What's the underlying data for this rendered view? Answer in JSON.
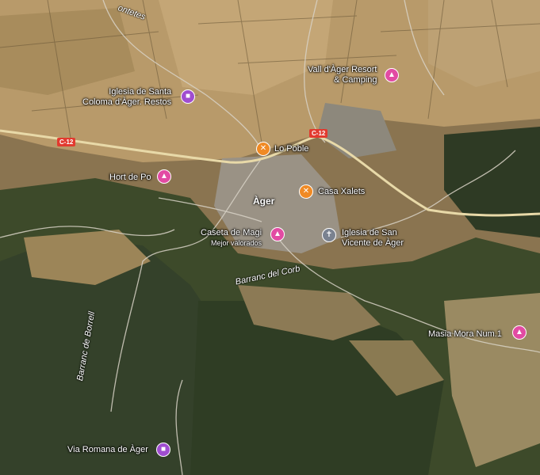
{
  "map": {
    "road_badge": "C-12",
    "town": "Àger",
    "roads": [
      {
        "name": "Barranc del Corb"
      },
      {
        "name": "Barranc de Borrell"
      },
      {
        "name": "ontetes"
      }
    ],
    "places": [
      {
        "name": "Vall d'Àger Resort",
        "name2": "& Camping",
        "type": "hotel"
      },
      {
        "name": "Iglesia de Santa",
        "name2": "Coloma d'Àger. Restos",
        "type": "sight"
      },
      {
        "name": "Lo Poble",
        "type": "food"
      },
      {
        "name": "Hort de Po",
        "type": "hotel"
      },
      {
        "name": "Casa Xalets",
        "type": "food"
      },
      {
        "name": "Caseta de Magi",
        "sub": "Mejor valorados",
        "type": "hotel"
      },
      {
        "name": "Iglesia de San",
        "name2": "Vicente de Àger",
        "type": "church"
      },
      {
        "name": "Masia Mora Num.1",
        "type": "hotel"
      },
      {
        "name": "Via Romana de Àger",
        "type": "sight"
      }
    ]
  }
}
